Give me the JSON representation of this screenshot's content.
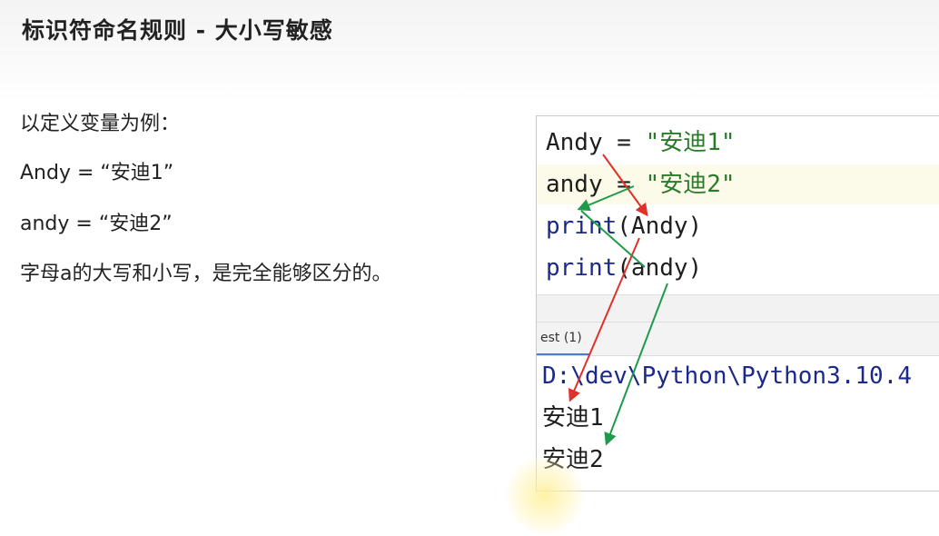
{
  "title": "标识符命名规则 - 大小写敏感",
  "left": {
    "line1": "以定义变量为例：",
    "line2": "Andy = “安迪1”",
    "line3": "andy = “安迪2”",
    "line4": "字母a的大写和小写，是完全能够区分的。"
  },
  "code": {
    "l1_var": "Andy",
    "l1_eq": " = ",
    "l1_str": "\"安迪1\"",
    "l2_var": "andy",
    "l2_eq": " = ",
    "l2_str": "\"安迪2\"",
    "l3_fn": "print",
    "l3_arg": "(Andy)",
    "l4_fn": "print",
    "l4_arg": "(andy)"
  },
  "run_tab": "est (1)",
  "output": {
    "path": "D:\\dev\\Python\\Python3.10.4",
    "out1": "安迪1",
    "out2": "安迪2"
  },
  "colors": {
    "keyword": "#1b2a8a",
    "string": "#2a7a2a",
    "arrow_red": "#e0302a",
    "arrow_green": "#1f9a4a"
  }
}
